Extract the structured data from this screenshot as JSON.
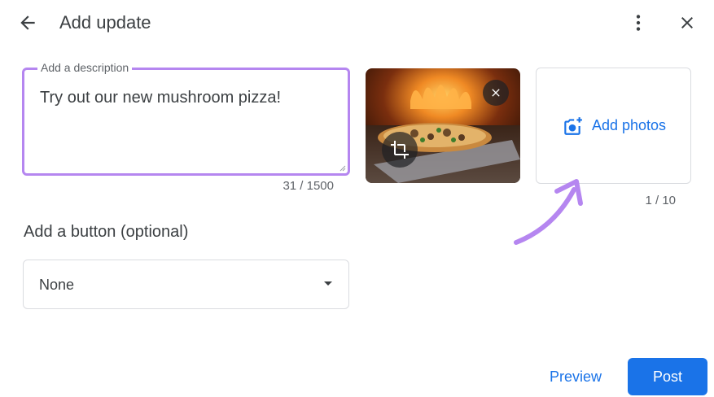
{
  "header": {
    "title": "Add update"
  },
  "description": {
    "label": "Add a description",
    "value": "Try out our new mushroom pizza!",
    "char_count": "31 / 1500"
  },
  "photos": {
    "add_label": "Add photos",
    "count": "1 / 10"
  },
  "button_section": {
    "heading": "Add a button (optional)",
    "selected": "None"
  },
  "footer": {
    "preview_label": "Preview",
    "post_label": "Post"
  },
  "colors": {
    "accent": "#1a73e8",
    "focus_border": "#b586f0",
    "annotation_arrow": "#b586f0"
  },
  "icons": [
    "arrow-back-icon",
    "more-vert-icon",
    "close-icon",
    "remove-photo-icon",
    "crop-icon",
    "add-photo-icon",
    "annotation-arrow"
  ]
}
